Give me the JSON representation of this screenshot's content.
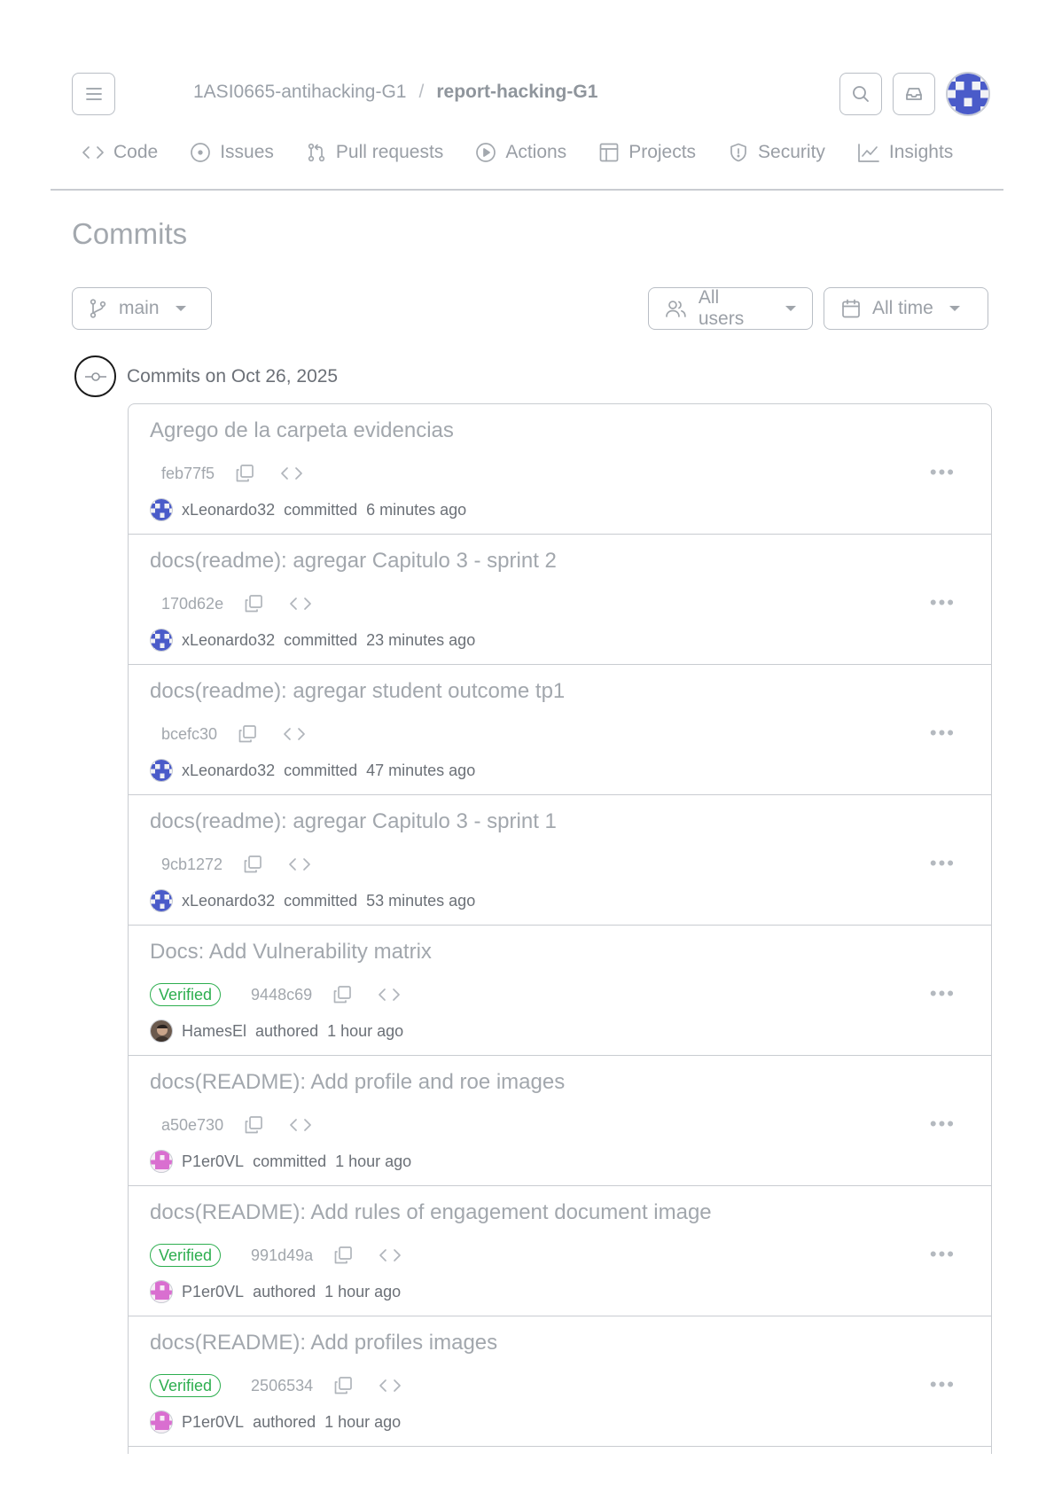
{
  "header": {
    "repo_owner": "1ASI0665-antihacking-G1",
    "separator": "/",
    "repo_name": "report-hacking-G1"
  },
  "tabs": [
    {
      "label": "Code",
      "icon": "code-icon"
    },
    {
      "label": "Issues",
      "icon": "issues-icon"
    },
    {
      "label": "Pull requests",
      "icon": "pull-request-icon"
    },
    {
      "label": "Actions",
      "icon": "play-icon"
    },
    {
      "label": "Projects",
      "icon": "table-icon"
    },
    {
      "label": "Security",
      "icon": "shield-icon"
    },
    {
      "label": "Insights",
      "icon": "graph-icon"
    }
  ],
  "page": {
    "title": "Commits"
  },
  "filters": {
    "branch": "main",
    "users": "All users",
    "time": "All time"
  },
  "group": {
    "date_label": "Commits on Oct 26, 2025"
  },
  "commits": [
    {
      "message": "Agrego de la carpeta evidencias",
      "verified": false,
      "sha": "feb77f5",
      "author": "xLeonardo32",
      "action": "committed",
      "when": "6 minutes ago",
      "avatar": "blue-identicon"
    },
    {
      "message": "docs(readme): agregar Capitulo 3 - sprint 2",
      "verified": false,
      "sha": "170d62e",
      "author": "xLeonardo32",
      "action": "committed",
      "when": "23 minutes ago",
      "avatar": "blue-identicon"
    },
    {
      "message": "docs(readme): agregar student outcome tp1",
      "verified": false,
      "sha": "bcefc30",
      "author": "xLeonardo32",
      "action": "committed",
      "when": "47 minutes ago",
      "avatar": "blue-identicon"
    },
    {
      "message": "docs(readme): agregar Capitulo 3 - sprint 1",
      "verified": false,
      "sha": "9cb1272",
      "author": "xLeonardo32",
      "action": "committed",
      "when": "53 minutes ago",
      "avatar": "blue-identicon"
    },
    {
      "message": "Docs: Add Vulnerability matrix",
      "verified": true,
      "verified_label": "Verified",
      "sha": "9448c69",
      "author": "HamesEl",
      "action": "authored",
      "when": "1 hour ago",
      "avatar": "photo-avatar"
    },
    {
      "message": "docs(README): Add profile and roe images",
      "verified": false,
      "sha": "a50e730",
      "author": "P1er0VL",
      "action": "committed",
      "when": "1 hour ago",
      "avatar": "pink-identicon"
    },
    {
      "message": "docs(README): Add rules of engagement document image",
      "verified": true,
      "verified_label": "Verified",
      "sha": "991d49a",
      "author": "P1er0VL",
      "action": "authored",
      "when": "1 hour ago",
      "avatar": "pink-identicon"
    },
    {
      "message": "docs(README): Add profiles images",
      "verified": true,
      "verified_label": "Verified",
      "sha": "2506534",
      "author": "P1er0VL",
      "action": "authored",
      "when": "1 hour ago",
      "avatar": "pink-identicon"
    }
  ],
  "colors": {
    "verified": "#2dae4f",
    "identicon_blue": "#4a5bc9",
    "identicon_pink": "#d96fd0"
  }
}
